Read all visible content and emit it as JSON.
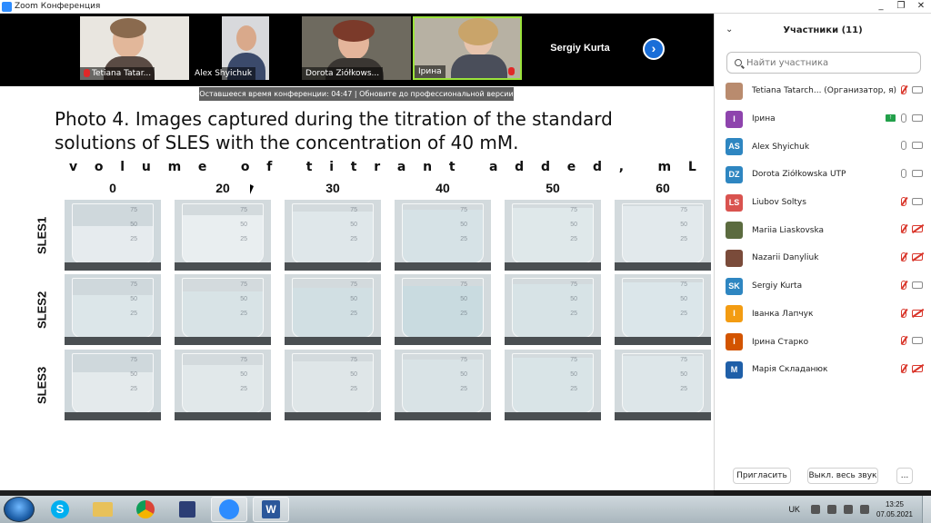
{
  "window": {
    "title": "Zoom Конференция",
    "buttons": [
      "_",
      "❐",
      "✕"
    ]
  },
  "video_strip": {
    "tiles": [
      {
        "name": "Tetiana Tatar..."
      },
      {
        "name": "Alex Shyichuk"
      },
      {
        "name": "Dorota Ziółkows..."
      },
      {
        "name": "Ірина"
      }
    ],
    "text_tile": "Sergiy Kurta",
    "next_icon": "›"
  },
  "banner": {
    "text": "Оставшееся время конференции: 04:47 | Обновите до профессиональной версии"
  },
  "slide": {
    "title": "Photo 4. Images captured during the titration of the standard solutions of SLES with the concentration of 40 mM.",
    "volume_label_chars": [
      "v",
      "o",
      "l",
      "u",
      "m",
      "e",
      "o",
      "f",
      "t",
      "i",
      "t",
      "r",
      "a",
      "n",
      "t",
      "a",
      "d",
      "d",
      "e",
      "d",
      ",",
      "m",
      "L"
    ],
    "columns": [
      "0",
      "20",
      "30",
      "40",
      "50",
      "60"
    ],
    "rows": [
      "SLES1",
      "SLES2",
      "SLES3"
    ],
    "photo_marks": [
      "75",
      "50",
      "25"
    ]
  },
  "panel": {
    "title": "Участники (11)",
    "search_placeholder": "Найти участника",
    "participants": [
      {
        "initials": "",
        "name": "Tetiana Tatarch... (Организатор, я)",
        "color": "#b98b6e",
        "mic": "off",
        "cam": "on",
        "share": false
      },
      {
        "initials": "I",
        "name": "Ірина",
        "color": "#8e44ad",
        "mic": "on",
        "cam": "on",
        "share": true
      },
      {
        "initials": "AS",
        "name": "Alex Shyichuk",
        "color": "#2e86c1",
        "mic": "on",
        "cam": "on",
        "share": false
      },
      {
        "initials": "DZ",
        "name": "Dorota Ziółkowska UTP",
        "color": "#2e86c1",
        "mic": "on",
        "cam": "on",
        "share": false
      },
      {
        "initials": "LS",
        "name": "Liubov Soltys",
        "color": "#d9534f",
        "mic": "off",
        "cam": "on",
        "share": false
      },
      {
        "initials": "",
        "name": "Mariia Liaskovska",
        "color": "#5b6b3f",
        "mic": "off",
        "cam": "off",
        "share": false
      },
      {
        "initials": "",
        "name": "Nazarii Danyliuk",
        "color": "#7a4b3a",
        "mic": "off",
        "cam": "off",
        "share": false
      },
      {
        "initials": "SK",
        "name": "Sergiy Kurta",
        "color": "#2e86c1",
        "mic": "off",
        "cam": "on",
        "share": false
      },
      {
        "initials": "I",
        "name": "Іванка Лапчук",
        "color": "#f39c12",
        "mic": "off",
        "cam": "off",
        "share": false
      },
      {
        "initials": "I",
        "name": "Ірина Старко",
        "color": "#d35400",
        "mic": "off",
        "cam": "on",
        "share": false
      },
      {
        "initials": "M",
        "name": "Марія Складанюк",
        "color": "#1f5fa8",
        "mic": "off",
        "cam": "off",
        "share": false
      }
    ],
    "footer": {
      "invite": "Пригласить",
      "mute_all": "Выкл. весь звук",
      "more": "..."
    }
  },
  "taskbar": {
    "apps": [
      "S",
      "",
      "",
      "",
      "",
      "W"
    ],
    "lang": "UK",
    "time": "13:25",
    "date": "07.05.2021"
  }
}
